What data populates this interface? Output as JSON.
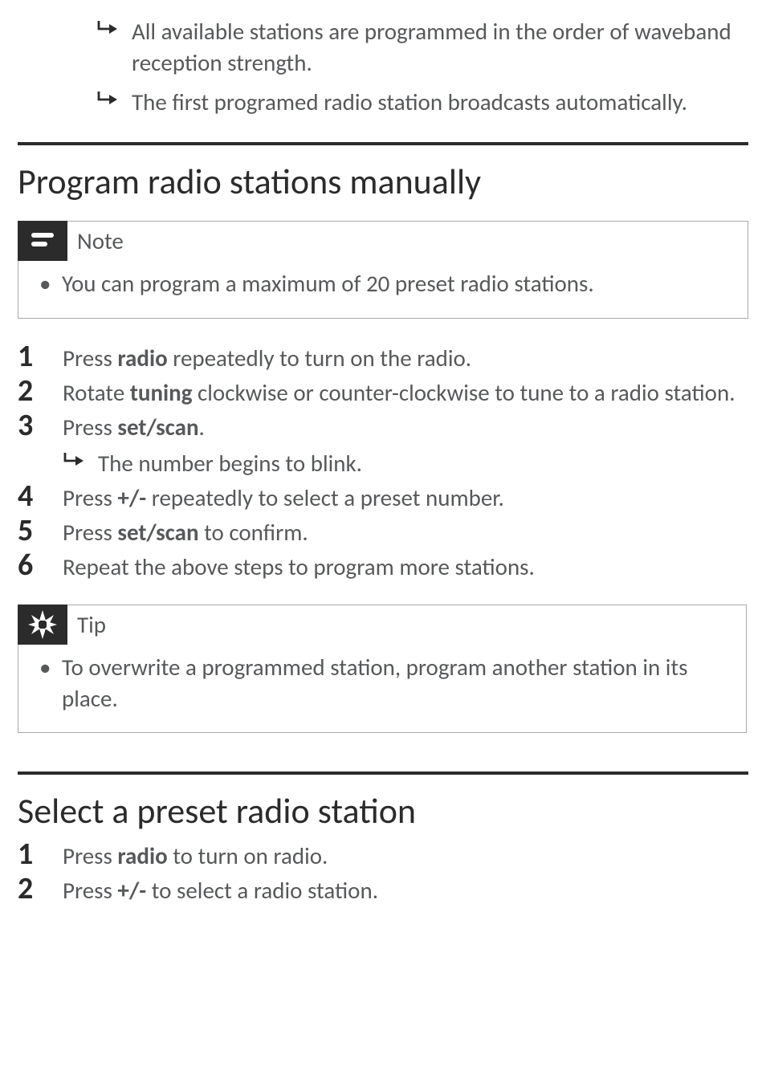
{
  "intro_results": [
    "All available stations are programmed in the order of waveband reception strength.",
    "The first programed radio station broadcasts automatically."
  ],
  "section_manual": {
    "title": "Program radio stations manually",
    "note_label": "Note",
    "note_items": [
      "You can program a maximum of 20 preset radio stations."
    ],
    "steps": [
      {
        "num": "1",
        "pre": "Press ",
        "bold": "radio",
        "post": " repeatedly to turn on the radio."
      },
      {
        "num": "2",
        "pre": "Rotate ",
        "bold": "tuning",
        "post": " clockwise or counter-clockwise to tune to a radio station."
      },
      {
        "num": "3",
        "pre": "Press ",
        "bold": "set/scan",
        "post": ".",
        "result": "The number begins to blink."
      },
      {
        "num": "4",
        "pre": "Press ",
        "bold": "+/-",
        "post": " repeatedly to select a preset number."
      },
      {
        "num": "5",
        "pre": "Press ",
        "bold": "set/scan",
        "post": " to confirm."
      },
      {
        "num": "6",
        "pre": "Repeat the above steps to program more stations.",
        "bold": "",
        "post": ""
      }
    ],
    "tip_label": "Tip",
    "tip_items": [
      "To overwrite a programmed station, program another station in its place."
    ]
  },
  "section_select": {
    "title": "Select a preset radio station",
    "steps": [
      {
        "num": "1",
        "pre": "Press ",
        "bold": "radio",
        "post": " to turn on radio."
      },
      {
        "num": "2",
        "pre": "Press ",
        "bold": "+/-",
        "post": " to select a radio station."
      }
    ]
  }
}
